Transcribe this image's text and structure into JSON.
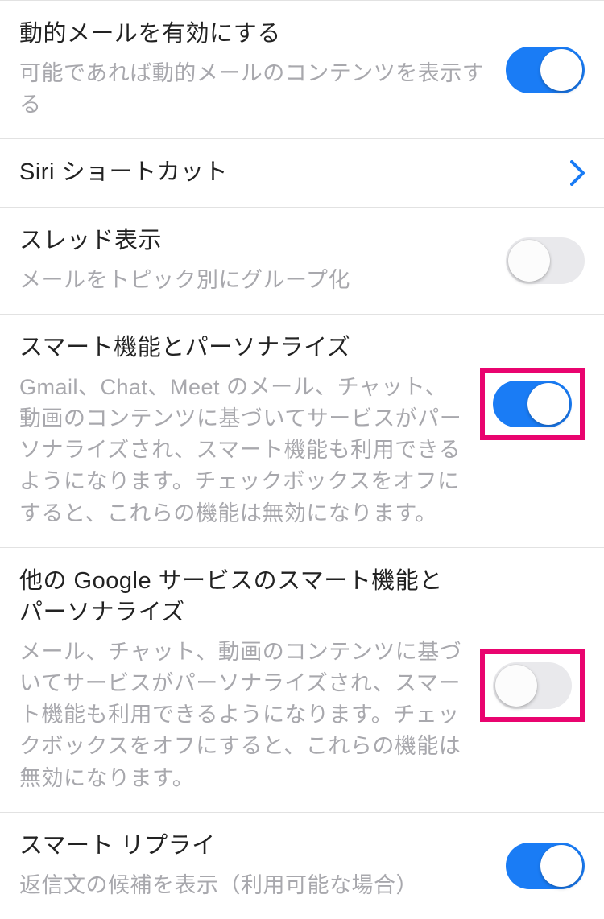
{
  "rows": {
    "dynamic_mail": {
      "title": "動的メールを有効にする",
      "desc": "可能であれば動的メールのコンテンツを表示する"
    },
    "siri": {
      "title": "Siri ショートカット"
    },
    "thread": {
      "title": "スレッド表示",
      "desc": "メールをトピック別にグループ化"
    },
    "smart_personalize": {
      "title": "スマート機能とパーソナライズ",
      "desc": "Gmail、Chat、Meet のメール、チャット、動画のコンテンツに基づいてサービスがパーソナライズされ、スマート機能も利用できるようになります。チェックボックスをオフにすると、これらの機能は無効になります。"
    },
    "other_google": {
      "title": "他の Google サービスのスマート機能とパーソナライズ",
      "desc": "メール、チャット、動画のコンテンツに基づいてサービスがパーソナライズされ、スマート機能も利用できるようになります。チェックボックスをオフにすると、これらの機能は無効になります。"
    },
    "smart_reply": {
      "title": "スマート リプライ",
      "desc": "返信文の候補を表示（利用可能な場合）"
    }
  },
  "toggles": {
    "dynamic_mail": true,
    "thread": false,
    "smart_personalize": true,
    "other_google": false,
    "smart_reply": true
  },
  "colors": {
    "toggle_on": "#1a7cf5",
    "toggle_off": "#e9e9ec",
    "highlight": "#e9046f",
    "chevron": "#1a7cf5"
  }
}
